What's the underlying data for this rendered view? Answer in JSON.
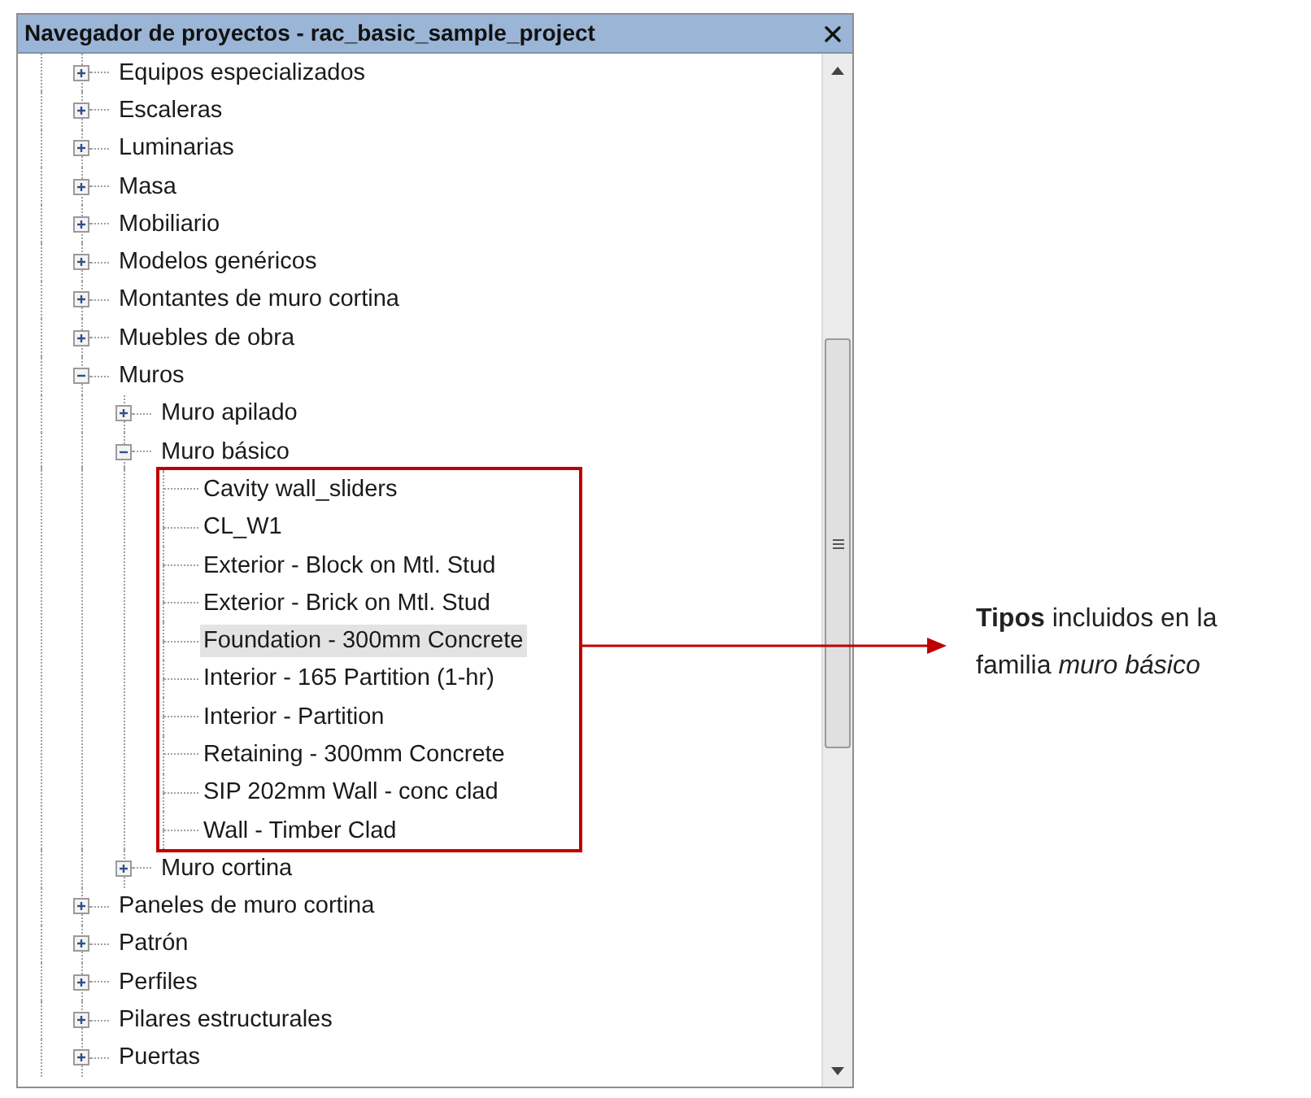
{
  "window": {
    "title": "Navegador de proyectos - rac_basic_sample_project"
  },
  "tree": [
    {
      "label": "Equipos especializados",
      "expanded": false,
      "selected": false
    },
    {
      "label": "Escaleras",
      "expanded": false,
      "selected": false
    },
    {
      "label": "Luminarias",
      "expanded": false,
      "selected": false
    },
    {
      "label": "Masa",
      "expanded": false,
      "selected": false
    },
    {
      "label": "Mobiliario",
      "expanded": false,
      "selected": false
    },
    {
      "label": "Modelos genéricos",
      "expanded": false,
      "selected": false
    },
    {
      "label": "Montantes de muro cortina",
      "expanded": false,
      "selected": false
    },
    {
      "label": "Muebles de obra",
      "expanded": false,
      "selected": false
    },
    {
      "label": "Muros",
      "expanded": true,
      "selected": false,
      "children": [
        {
          "label": "Muro apilado",
          "expanded": false,
          "selected": false
        },
        {
          "label": "Muro básico",
          "expanded": true,
          "selected": false,
          "boxed": true,
          "children": [
            {
              "label": "Cavity wall_sliders",
              "selected": false
            },
            {
              "label": "CL_W1",
              "selected": false
            },
            {
              "label": "Exterior - Block on Mtl. Stud",
              "selected": false
            },
            {
              "label": "Exterior - Brick on Mtl. Stud",
              "selected": false
            },
            {
              "label": "Foundation - 300mm Concrete",
              "selected": true
            },
            {
              "label": "Interior - 165 Partition (1-hr)",
              "selected": false
            },
            {
              "label": "Interior - Partition",
              "selected": false
            },
            {
              "label": "Retaining - 300mm Concrete",
              "selected": false
            },
            {
              "label": "SIP 202mm Wall - conc clad",
              "selected": false
            },
            {
              "label": "Wall - Timber Clad",
              "selected": false
            }
          ]
        },
        {
          "label": "Muro cortina",
          "expanded": false,
          "selected": false
        }
      ]
    },
    {
      "label": "Paneles de muro cortina",
      "expanded": false,
      "selected": false
    },
    {
      "label": "Patrón",
      "expanded": false,
      "selected": false
    },
    {
      "label": "Perfiles",
      "expanded": false,
      "selected": false
    },
    {
      "label": "Pilares estructurales",
      "expanded": false,
      "selected": false
    },
    {
      "label": "Puertas",
      "expanded": false,
      "selected": false
    }
  ],
  "annotation": {
    "text": "**Tipos** incluidos en la familia *muro básico*"
  }
}
